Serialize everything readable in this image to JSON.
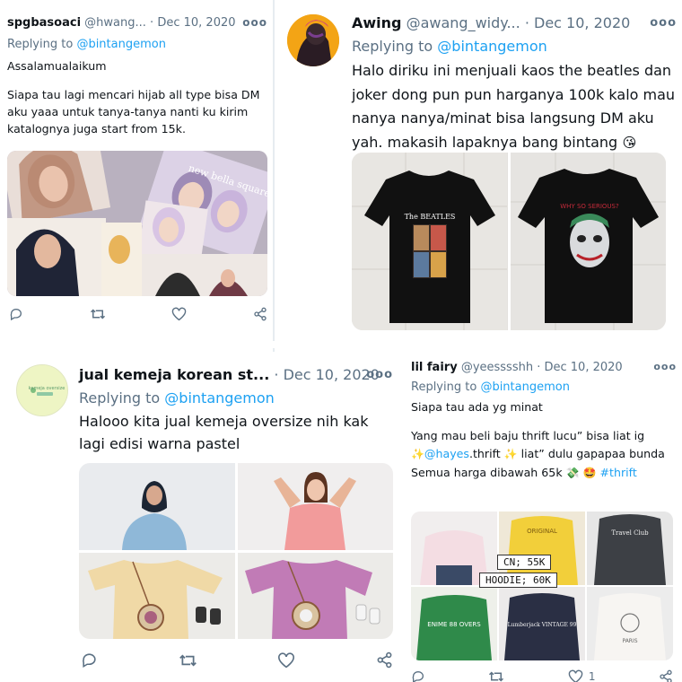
{
  "tweets": [
    {
      "name": "spgbasoaci",
      "handle": "@hwang...",
      "date": "Dec 10, 2020",
      "more": "ooo",
      "reply_prefix": "Replying to",
      "reply_mention": "@bintangemon",
      "body": [
        "Assalamualaikum",
        "",
        "Siapa tau lagi mencari hijab all type bisa DM aku yaaa untuk tanya-tanya nanti ku kirim katalognya juga start from 15k."
      ],
      "media_caption": "new bella square"
    },
    {
      "name": "Awing",
      "handle": "@awang_widy...",
      "date": "Dec 10, 2020",
      "more": "ooo",
      "reply_prefix": "Replying to",
      "reply_mention": "@bintangemon",
      "body_text": "Halo diriku ini menjuali kaos the beatles dan joker dong pun pun harganya 100k kalo mau nanya nanya/minat bisa langsung DM aku yah. makasih lapaknya bang bintang",
      "body_emoji": "😘",
      "shirt1_print": "The BEATLES",
      "shirt2_print": "WHY SO SERIOUS?"
    },
    {
      "name": "jual kemeja korean st...",
      "date": "Dec 10, 2020",
      "more": "ooo",
      "reply_prefix": "Replying to",
      "reply_mention": "@bintangemon",
      "body_text": "Halooo kita jual kemeja oversize nih kak lagi edisi warna pastel",
      "avatar_text": "kemeja oversize"
    },
    {
      "name": "lil fairy",
      "handle": "@yeesssshh",
      "date": "Dec 10, 2020",
      "more": "ooo",
      "reply_prefix": "Replying to",
      "reply_mention": "@bintangemon",
      "line1": "Siapa tau ada yg minat",
      "line2": "Yang mau beli baju thrift lucu” bisa liat ig",
      "sparkle": "✨",
      "ig_handle": "@hayes",
      "ig_suffix": ".thrift",
      "line3_tail": "liat” dulu gapapaa bunda",
      "line4": "Semua harga dibawah 65k",
      "money_emoji": "💸",
      "star_emoji": "🤩",
      "hashtag": "#thrift",
      "price_cn": "CN; 55K",
      "price_hoodie": "HOODIE; 60K",
      "like_count": "1",
      "sweater_texts": [
        "ORIGINAL",
        "Travel Club",
        "ENIME 88 OVERS",
        "Lumberjack VINTAGE 99",
        "PARIS"
      ]
    }
  ]
}
